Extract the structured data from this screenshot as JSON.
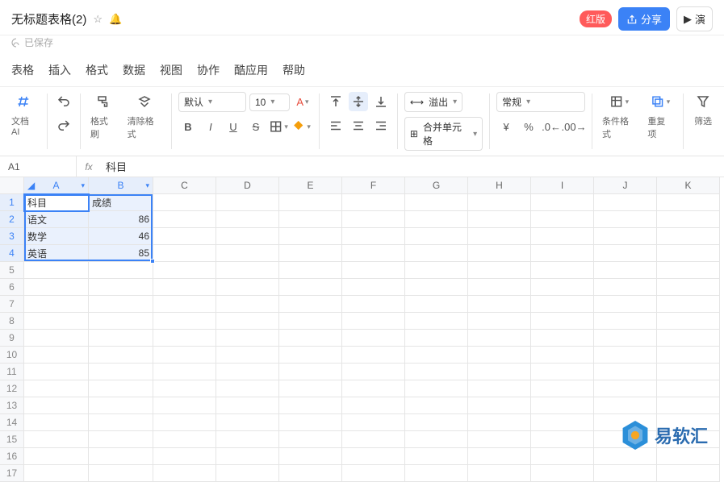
{
  "titlebar": {
    "title": "无标题表格(2)",
    "saved": "已保存",
    "badge": "红版",
    "share": "分享",
    "play": "演"
  },
  "menu": {
    "items": [
      "表格",
      "插入",
      "格式",
      "数据",
      "视图",
      "协作",
      "酷应用",
      "帮助"
    ]
  },
  "toolbar": {
    "docai": "文档AI",
    "format_painter": "格式刷",
    "clear_format": "清除格式",
    "font": "默认",
    "size": "10",
    "overflow": "溢出",
    "merge": "合并单元格",
    "number_format": "常规",
    "cond_fmt": "条件格式",
    "dedupe": "重复项",
    "filter": "筛选"
  },
  "formula": {
    "ref": "A1",
    "value": "科目"
  },
  "columns": [
    "A",
    "B",
    "C",
    "D",
    "E",
    "F",
    "G",
    "H",
    "I",
    "J",
    "K"
  ],
  "rows": 17,
  "selection": {
    "r1": 1,
    "c1": 1,
    "r2": 4,
    "c2": 2
  },
  "chart_data": {
    "type": "table",
    "headers": [
      "科目",
      "成绩"
    ],
    "rows": [
      [
        "语文",
        86
      ],
      [
        "数学",
        46
      ],
      [
        "英语",
        85
      ]
    ]
  },
  "cells": {
    "A1": "科目",
    "B1": "成绩",
    "A2": "语文",
    "B2": "86",
    "A3": "数学",
    "B3": "46",
    "A4": "英语",
    "B4": "85"
  },
  "watermark": "易软汇"
}
